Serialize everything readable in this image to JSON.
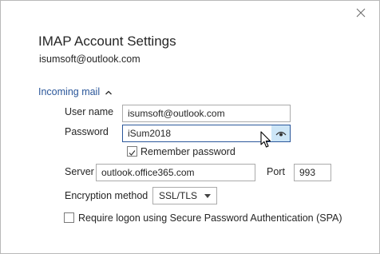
{
  "dialog": {
    "title": "IMAP Account Settings",
    "account_email": "isumsoft@outlook.com"
  },
  "incoming": {
    "section_label": "Incoming mail",
    "username_label": "User name",
    "username_value": "isumsoft@outlook.com",
    "password_label": "Password",
    "password_value": "iSum2018",
    "remember_label": "Remember password",
    "remember_checked": true,
    "server_label": "Server",
    "server_value": "outlook.office365.com",
    "port_label": "Port",
    "port_value": "993",
    "encryption_label": "Encryption method",
    "encryption_value": "SSL/TLS",
    "spa_label": "Require logon using Secure Password Authentication (SPA)",
    "spa_checked": false
  },
  "colors": {
    "accent": "#2b579a",
    "reveal_hover": "#cde6f7"
  },
  "icons": [
    "close-icon",
    "chevron-up-icon",
    "eye-icon",
    "checkmark-icon",
    "dropdown-arrow-icon",
    "mouse-cursor-icon"
  ]
}
